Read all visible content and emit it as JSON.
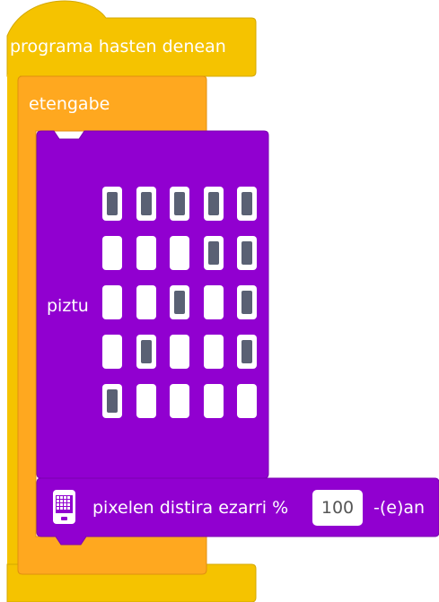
{
  "hat_block": {
    "label": "programa hasten denean",
    "color": "#f5c300"
  },
  "forever_block": {
    "label": "etengabe",
    "color": "#ffa81f"
  },
  "show_leds_block": {
    "label": "piztu",
    "color": "#9100d0",
    "leds": [
      [
        1,
        1,
        1,
        1,
        1
      ],
      [
        0,
        0,
        0,
        1,
        1
      ],
      [
        0,
        0,
        1,
        0,
        1
      ],
      [
        0,
        1,
        0,
        0,
        1
      ],
      [
        1,
        0,
        0,
        0,
        0
      ]
    ]
  },
  "brightness_block": {
    "icon": "led-matrix-icon",
    "label": "pixelen distira ezarri %",
    "value": "100",
    "suffix": "-(e)an",
    "color": "#9100d0"
  }
}
